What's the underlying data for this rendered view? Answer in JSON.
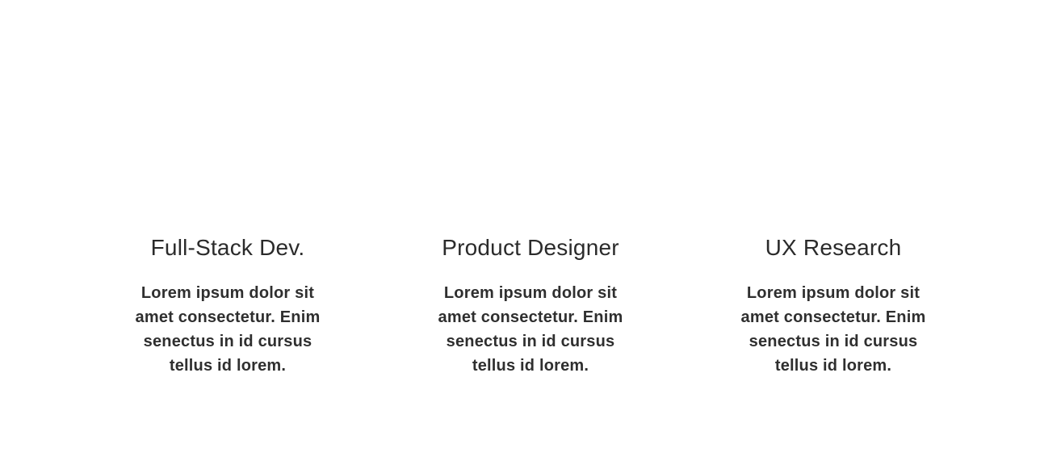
{
  "roles": [
    {
      "title": "Full-Stack Dev.",
      "description": "Lorem ipsum dolor sit amet consectetur. Enim senectus in id cursus tellus id lorem."
    },
    {
      "title": "Product Designer",
      "description": "Lorem ipsum dolor sit amet consectetur. Enim senectus in id cursus tellus id lorem."
    },
    {
      "title": "UX Research",
      "description": "Lorem ipsum dolor sit amet consectetur. Enim senectus in id cursus tellus id lorem."
    }
  ]
}
